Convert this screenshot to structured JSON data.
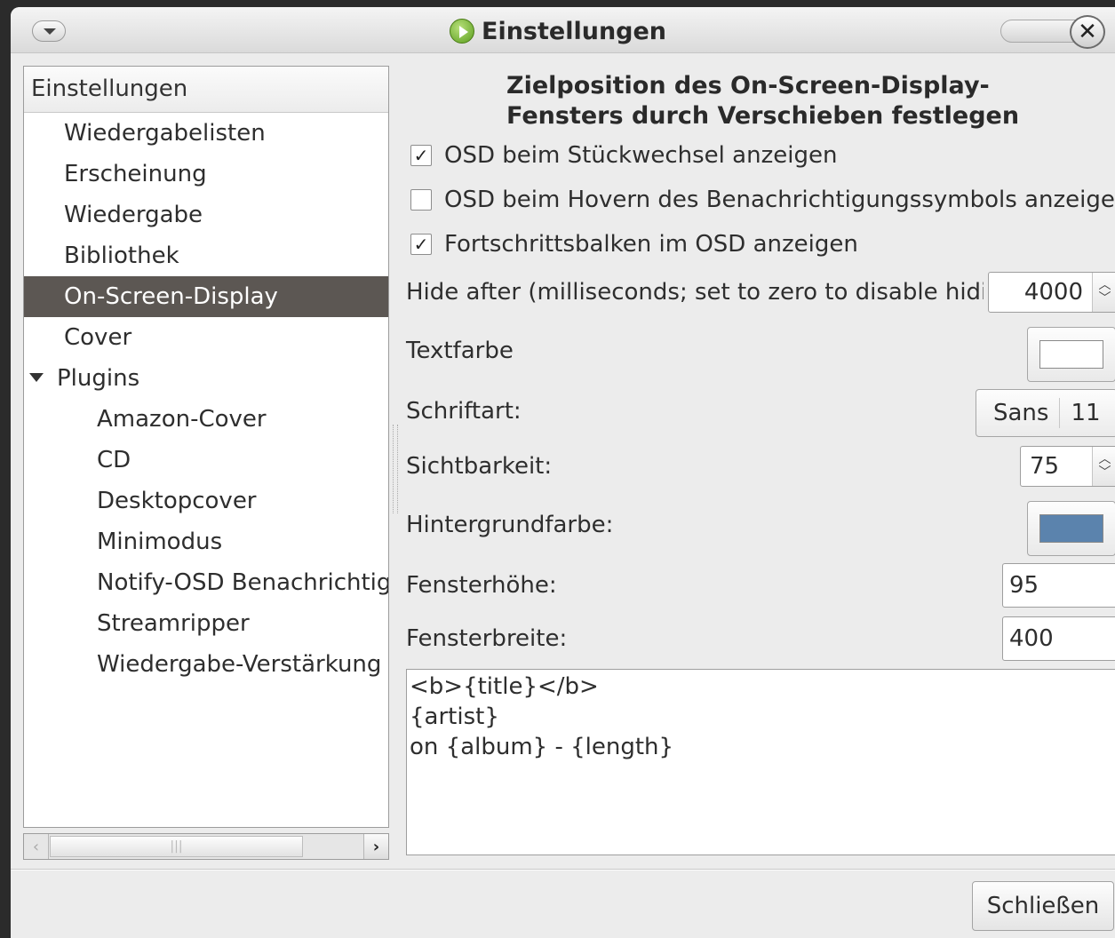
{
  "window": {
    "title": "Einstellungen",
    "close_glyph": "✕"
  },
  "sidebar": {
    "header": "Einstellungen",
    "items": [
      {
        "label": "Wiedergabelisten"
      },
      {
        "label": "Erscheinung"
      },
      {
        "label": "Wiedergabe"
      },
      {
        "label": "Bibliothek"
      },
      {
        "label": "On-Screen-Display"
      },
      {
        "label": "Cover"
      },
      {
        "label": "Plugins"
      }
    ],
    "plugins": [
      {
        "label": "Amazon-Cover"
      },
      {
        "label": "CD"
      },
      {
        "label": "Desktopcover"
      },
      {
        "label": "Minimodus"
      },
      {
        "label": "Notify-OSD Benachrichtigung"
      },
      {
        "label": "Streamripper"
      },
      {
        "label": "Wiedergabe-Verstärkung"
      }
    ],
    "selected": "On-Screen-Display"
  },
  "osd": {
    "heading": "Zielposition des On-Screen-Display-Fensters durch Verschieben festlegen",
    "show_on_track_change": {
      "label": "OSD beim Stückwechsel anzeigen",
      "checked": "✓"
    },
    "show_on_tray_hover": {
      "label": "OSD beim Hovern des Benachrichtigungssymbols anzeigen",
      "checked": ""
    },
    "show_progress": {
      "label": "Fortschrittsbalken im OSD anzeigen",
      "checked": "✓"
    },
    "hide_after": {
      "label": "Hide after (milliseconds; set to zero to disable hiding):",
      "value": "4000"
    },
    "text_color": {
      "label": "Textfarbe",
      "color": "#ffffff"
    },
    "font": {
      "label": "Schriftart:",
      "name": "Sans",
      "size": "11"
    },
    "opacity": {
      "label": "Sichtbarkeit:",
      "value": "75"
    },
    "bg_color": {
      "label": "Hintergrundfarbe:",
      "color": "#5b83ad"
    },
    "height": {
      "label": "Fensterhöhe:",
      "value": "95"
    },
    "width": {
      "label": "Fensterbreite:",
      "value": "400"
    },
    "template": "<b>{title}</b>\n{artist}\non {album} - {length}"
  },
  "footer": {
    "close_label": "Schließen"
  },
  "icons": {
    "app": "play-icon",
    "menu": "chevron-down-icon",
    "expander": "expander-down-icon"
  }
}
